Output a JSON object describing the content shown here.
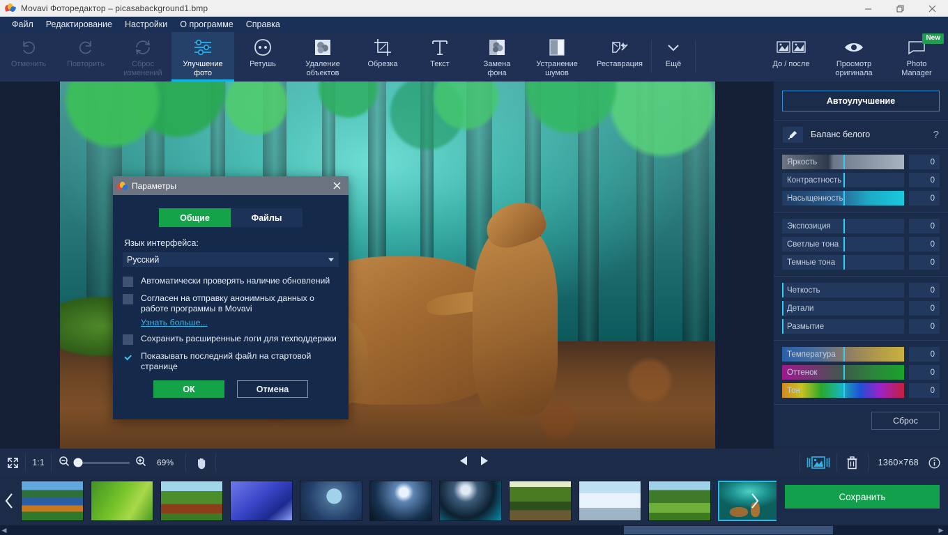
{
  "window": {
    "title": "Movavi Фоторедактор – picasabackground1.bmp",
    "app_icon": "movavi-logo-icon",
    "minimize": "minimize-icon",
    "maximize": "restore-icon",
    "close": "close-icon"
  },
  "menubar": {
    "items": [
      {
        "label": "Файл",
        "name": "menu-file"
      },
      {
        "label": "Редактирование",
        "name": "menu-edit"
      },
      {
        "label": "Настройки",
        "name": "menu-settings"
      },
      {
        "label": "О программе",
        "name": "menu-about"
      },
      {
        "label": "Справка",
        "name": "menu-help"
      }
    ]
  },
  "toolbar": {
    "items": [
      {
        "label": "Отменить",
        "icon": "undo-icon",
        "state": "disabled"
      },
      {
        "label": "Повторить",
        "icon": "redo-icon",
        "state": "disabled"
      },
      {
        "label": "Сброс\nизменений",
        "line1": "Сброс",
        "line2": "изменений",
        "icon": "reset-icon",
        "state": "disabled"
      },
      {
        "label": "Улучшение фото",
        "line1": "Улучшение",
        "line2": "фото",
        "icon": "adjust-sliders-icon",
        "state": "active"
      },
      {
        "label": "Ретушь",
        "line1": "Ретушь",
        "line2": "",
        "icon": "retouch-face-icon",
        "state": "normal"
      },
      {
        "label": "Удаление объектов",
        "line1": "Удаление",
        "line2": "объектов",
        "icon": "object-removal-icon",
        "state": "normal"
      },
      {
        "label": "Обрезка",
        "line1": "Обрезка",
        "line2": "",
        "icon": "crop-icon",
        "state": "normal"
      },
      {
        "label": "Текст",
        "line1": "Текст",
        "line2": "",
        "icon": "text-icon",
        "state": "normal"
      },
      {
        "label": "Замена фона",
        "line1": "Замена",
        "line2": "фона",
        "icon": "background-replace-icon",
        "state": "normal"
      },
      {
        "label": "Устранение шумов",
        "line1": "Устранение",
        "line2": "шумов",
        "icon": "denoise-icon",
        "state": "normal"
      },
      {
        "label": "Реставрация",
        "line1": "Реставрация",
        "line2": "",
        "icon": "restoration-icon",
        "state": "normal"
      },
      {
        "label": "Ещё",
        "line1": "Ещё",
        "line2": "",
        "icon": "chevron-down-icon",
        "state": "normal"
      }
    ],
    "right_items": [
      {
        "label": "До / после",
        "line1": "До / после",
        "line2": "",
        "icon": "before-after-icon"
      },
      {
        "label": "Просмотр оригинала",
        "line1": "Просмотр",
        "line2": "оригинала",
        "icon": "eye-icon"
      },
      {
        "label": "Photo Manager",
        "line1": "Photo",
        "line2": "Manager",
        "icon": "photo-manager-icon",
        "badge": "New"
      }
    ]
  },
  "dialog": {
    "title": "Параметры",
    "icon": "movavi-logo-icon",
    "close": "close-icon",
    "tabs": [
      {
        "label": "Общие",
        "selected": true
      },
      {
        "label": "Файлы",
        "selected": false
      }
    ],
    "language_label": "Язык интерфейса:",
    "language_value": "Русский",
    "checkboxes": [
      {
        "label": "Автоматически проверять наличие обновлений",
        "checked": false
      },
      {
        "label": "Согласен на отправку анонимных данных о работе программы в Movavi",
        "checked": false
      },
      {
        "label": "Сохранить расширенные логи для техподдержки",
        "checked": false
      },
      {
        "label": "Показывать последний файл на стартовой странице",
        "checked": true
      }
    ],
    "learn_more": "Узнать больше...",
    "ok": "ОК",
    "cancel": "Отмена"
  },
  "right_panel": {
    "auto_enhance": "Автоулучшение",
    "white_balance": {
      "label": "Баланс белого",
      "icon": "eyedropper-icon",
      "help": "?"
    },
    "slider_groups": [
      {
        "sliders": [
          {
            "label": "Яркость",
            "value": "0",
            "fill": "brightness-gradient"
          },
          {
            "label": "Контрастность",
            "value": "0",
            "fill": "plain"
          },
          {
            "label": "Насыщенность",
            "value": "0",
            "fill": "saturation-gradient"
          }
        ]
      },
      {
        "sliders": [
          {
            "label": "Экспозиция",
            "value": "0",
            "fill": "plain"
          },
          {
            "label": "Светлые тона",
            "value": "0",
            "fill": "plain"
          },
          {
            "label": "Темные тона",
            "value": "0",
            "fill": "plain"
          }
        ]
      },
      {
        "sliders": [
          {
            "label": "Четкость",
            "value": "0",
            "fill": "plain",
            "knob_left": true
          },
          {
            "label": "Детали",
            "value": "0",
            "fill": "plain",
            "knob_left": true
          },
          {
            "label": "Размытие",
            "value": "0",
            "fill": "plain",
            "knob_left": true
          }
        ]
      },
      {
        "sliders": [
          {
            "label": "Температура",
            "value": "0",
            "fill": "temperature-gradient"
          },
          {
            "label": "Оттенок",
            "value": "0",
            "fill": "tint-gradient"
          },
          {
            "label": "Тон",
            "value": "0",
            "fill": "hue-gradient"
          }
        ]
      }
    ],
    "reset": "Сброс",
    "save": "Сохранить"
  },
  "bottom_bar": {
    "fit_icon": "fit-to-screen-icon",
    "actual_size": "1:1",
    "zoom_out_icon": "zoom-out-icon",
    "zoom_in_icon": "zoom-in-icon",
    "zoom_percent": "69%",
    "pan_icon": "hand-pan-icon",
    "prev_icon": "prev-triangle-icon",
    "next_icon": "next-triangle-icon",
    "filmstrip_toggle_icon": "filmstrip-toggle-icon",
    "delete_icon": "trash-icon",
    "dimensions": "1360×768",
    "info_icon": "info-icon"
  },
  "filmstrip": {
    "prev_arrow_icon": "chevron-left-icon",
    "next_arrow_icon": "chevron-right-icon",
    "thumbnails": [
      {
        "name": "thumb-mountain-lake",
        "selected": false
      },
      {
        "name": "thumb-green-grass",
        "selected": false
      },
      {
        "name": "thumb-birch-path",
        "selected": false
      },
      {
        "name": "thumb-blue-winter-stream",
        "selected": false
      },
      {
        "name": "thumb-frost-moon-trees",
        "selected": false
      },
      {
        "name": "thumb-moon-over-sea",
        "selected": false
      },
      {
        "name": "thumb-moon-clouds-water",
        "selected": false
      },
      {
        "name": "thumb-forest-stream",
        "selected": false
      },
      {
        "name": "thumb-snowy-road",
        "selected": false
      },
      {
        "name": "thumb-green-meadow-lake",
        "selected": false
      },
      {
        "name": "thumb-bears-forest",
        "selected": true
      }
    ]
  },
  "colors": {
    "accent_blue": "#13b0e6",
    "accent_green": "#15a34a",
    "panel_bg": "#1b2b4a",
    "toolbar_bg": "#1f3054",
    "menubar_bg": "#1b3057",
    "dialog_bg": "#15294a",
    "link": "#35b5e6"
  }
}
